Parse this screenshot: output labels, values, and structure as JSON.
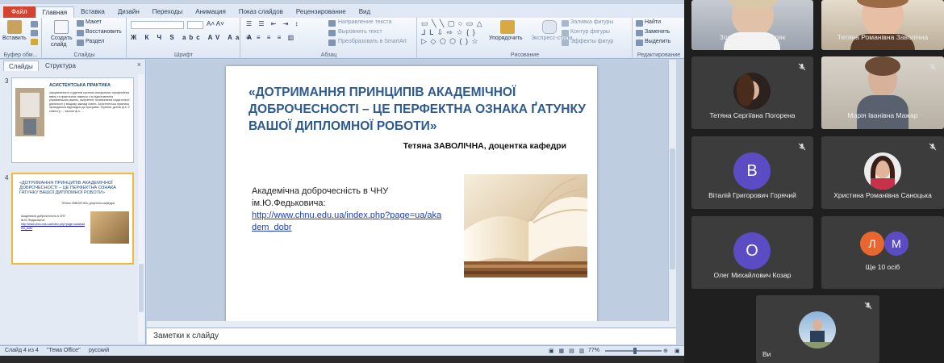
{
  "ribbon": {
    "tabs": [
      "Файл",
      "Главная",
      "Вставка",
      "Дизайн",
      "Переходы",
      "Анимация",
      "Показ слайдов",
      "Рецензирование",
      "Вид"
    ],
    "clipboard": {
      "paste": "Вставить",
      "label": "Буфер обм..."
    },
    "slides": {
      "new_slide": "Создать слайд",
      "layout": "Макет",
      "reset": "Восстановить",
      "section": "Раздел",
      "label": "Слайды"
    },
    "font": {
      "label": "Шрифт"
    },
    "paragraph": {
      "text_direction": "Направление текста",
      "align_text": "Выровнять текст",
      "smartart": "Преобразовать в SmartArt",
      "label": "Абзац"
    },
    "drawing": {
      "arrange": "Упорядочить",
      "quick_styles": "Экспресс-стили",
      "shape_fill": "Заливка фигуры",
      "shape_outline": "Контур фигуры",
      "shape_effects": "Эффекты фигур",
      "label": "Рисование"
    },
    "editing": {
      "find": "Найти",
      "replace": "Заменить",
      "select": "Выделить",
      "label": "Редактирование"
    }
  },
  "left_panel": {
    "tabs": [
      "Слайды",
      "Структура"
    ],
    "close": "×",
    "thumb3": {
      "number": "3",
      "title": "АСИСТЕНТСЬКА ПРАКТИКА",
      "text": "оформлення в студентів системи спеціальних професійних вмінь та практичних навичок з ім підготовлення управлінських рішень, залучення та виконання педагогічної діяльності у вищому закладі освіти. Асистентська практика проводиться відповідно до програми. Терміни: денна ф.н. 2 семестр ...; заочна ф.н. ..."
    },
    "thumb4": {
      "number": "4",
      "title": "«ДОТРИМАННЯ ПРИНЦИПІВ АКАДЕМІЧНОЇ ДОБРОЧЕСНОСТІ – ЦЕ ПЕРФЕКТНА ОЗНАКА ҐАТУНКУ ВАШОЇ ДИПЛОМНОЇ РОБОТИ»",
      "author": "Тетяна ЗАВОЛІЧНА, доцентка кафедри",
      "body": "Академічна доброчесність в ЧНУ ім.Ю.Федьковича:",
      "link": "http://www.chnu.edu.ua/index.php?page=ua/akadem_dobr"
    }
  },
  "slide": {
    "title": "«ДОТРИМАННЯ ПРИНЦИПІВ АКАДЕМІЧНОЇ ДОБРОЧЕСНОСТІ – ЦЕ ПЕРФЕКТНА ОЗНАКА ҐАТУНКУ ВАШОЇ ДИПЛОМНОЇ РОБОТИ»",
    "author": "Тетяна ЗАВОЛІЧНА, доцентка кафедри",
    "body": "Академічна доброчесність в ЧНУ ім.Ю.Федьковича:",
    "link": "http://www.chnu.edu.ua/index.php?page=ua/akadem_dobr"
  },
  "notes": {
    "placeholder": "Заметки к слайду"
  },
  "status": {
    "slide_pos": "Слайд 4 из 4",
    "theme": "\"Тема Office\"",
    "language": "русский",
    "zoom": "77%"
  },
  "participants": [
    {
      "name": "Зоя Іванівна Гуцуляк",
      "kind": "video"
    },
    {
      "name": "Тетяна Романівна Заволічна",
      "kind": "video"
    },
    {
      "name": "Тетяна Сергіївна Погорена",
      "kind": "photo",
      "muted": true
    },
    {
      "name": "Марія Іванівна Мажар",
      "kind": "video",
      "muted": true
    },
    {
      "name": "Віталій Григорович Горячий",
      "kind": "letter",
      "letter": "В",
      "color": "#5b4cc4",
      "muted": true
    },
    {
      "name": "Христина Романівна Саноцька",
      "kind": "photo",
      "muted": true
    },
    {
      "name": "Олег Михайлович Козар",
      "kind": "letter",
      "letter": "О",
      "color": "#5b4cc4",
      "muted": true
    },
    {
      "name": "Ще 10 осіб",
      "kind": "group",
      "letters": [
        "Л",
        "М"
      ],
      "colors": [
        "#e8662f",
        "#5b4cc4"
      ]
    },
    {
      "name": "Ви",
      "kind": "photo",
      "muted": true
    }
  ]
}
